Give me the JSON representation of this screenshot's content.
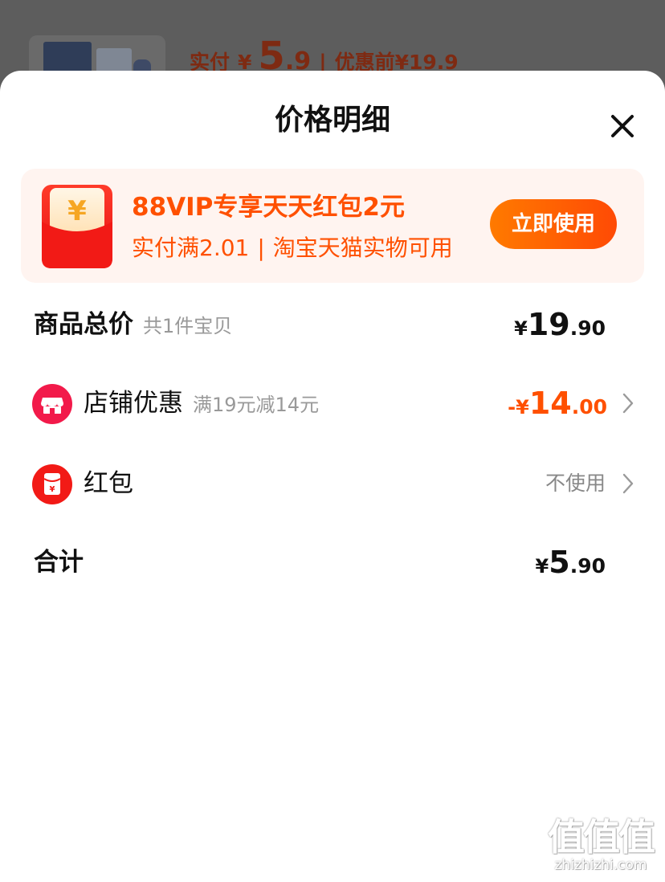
{
  "background": {
    "paid_label": "实付",
    "paid_currency": "¥",
    "paid_integer": "5",
    "paid_decimal": ".9",
    "separator": "|",
    "original_label": "优惠前",
    "original_price": "¥19.9"
  },
  "sheet": {
    "title": "价格明细",
    "close_icon": "close-icon"
  },
  "promo": {
    "title": "88VIP专享天天红包2元",
    "condition": "实付满2.01",
    "separator": "|",
    "scope": "淘宝天猫实物可用",
    "button_label": "立即使用",
    "icon": "red-packet-icon",
    "accent_color": "#ff5000"
  },
  "rows": {
    "subtotal": {
      "label": "商品总价",
      "note": "共1件宝贝",
      "currency": "¥",
      "integer": "19",
      "decimal": ".90"
    },
    "store_discount": {
      "label": "店铺优惠",
      "note": "满19元减14元",
      "prefix": "-¥",
      "integer": "14",
      "decimal": ".00",
      "icon": "store-icon",
      "color": "#ff5000"
    },
    "red_packet": {
      "label": "红包",
      "status": "不使用",
      "icon": "red-packet-icon"
    },
    "total": {
      "label": "合计",
      "currency": "¥",
      "integer": "5",
      "decimal": ".90"
    }
  },
  "watermark": {
    "logo_text": "值值值",
    "url": "zhizhizhi.com"
  }
}
